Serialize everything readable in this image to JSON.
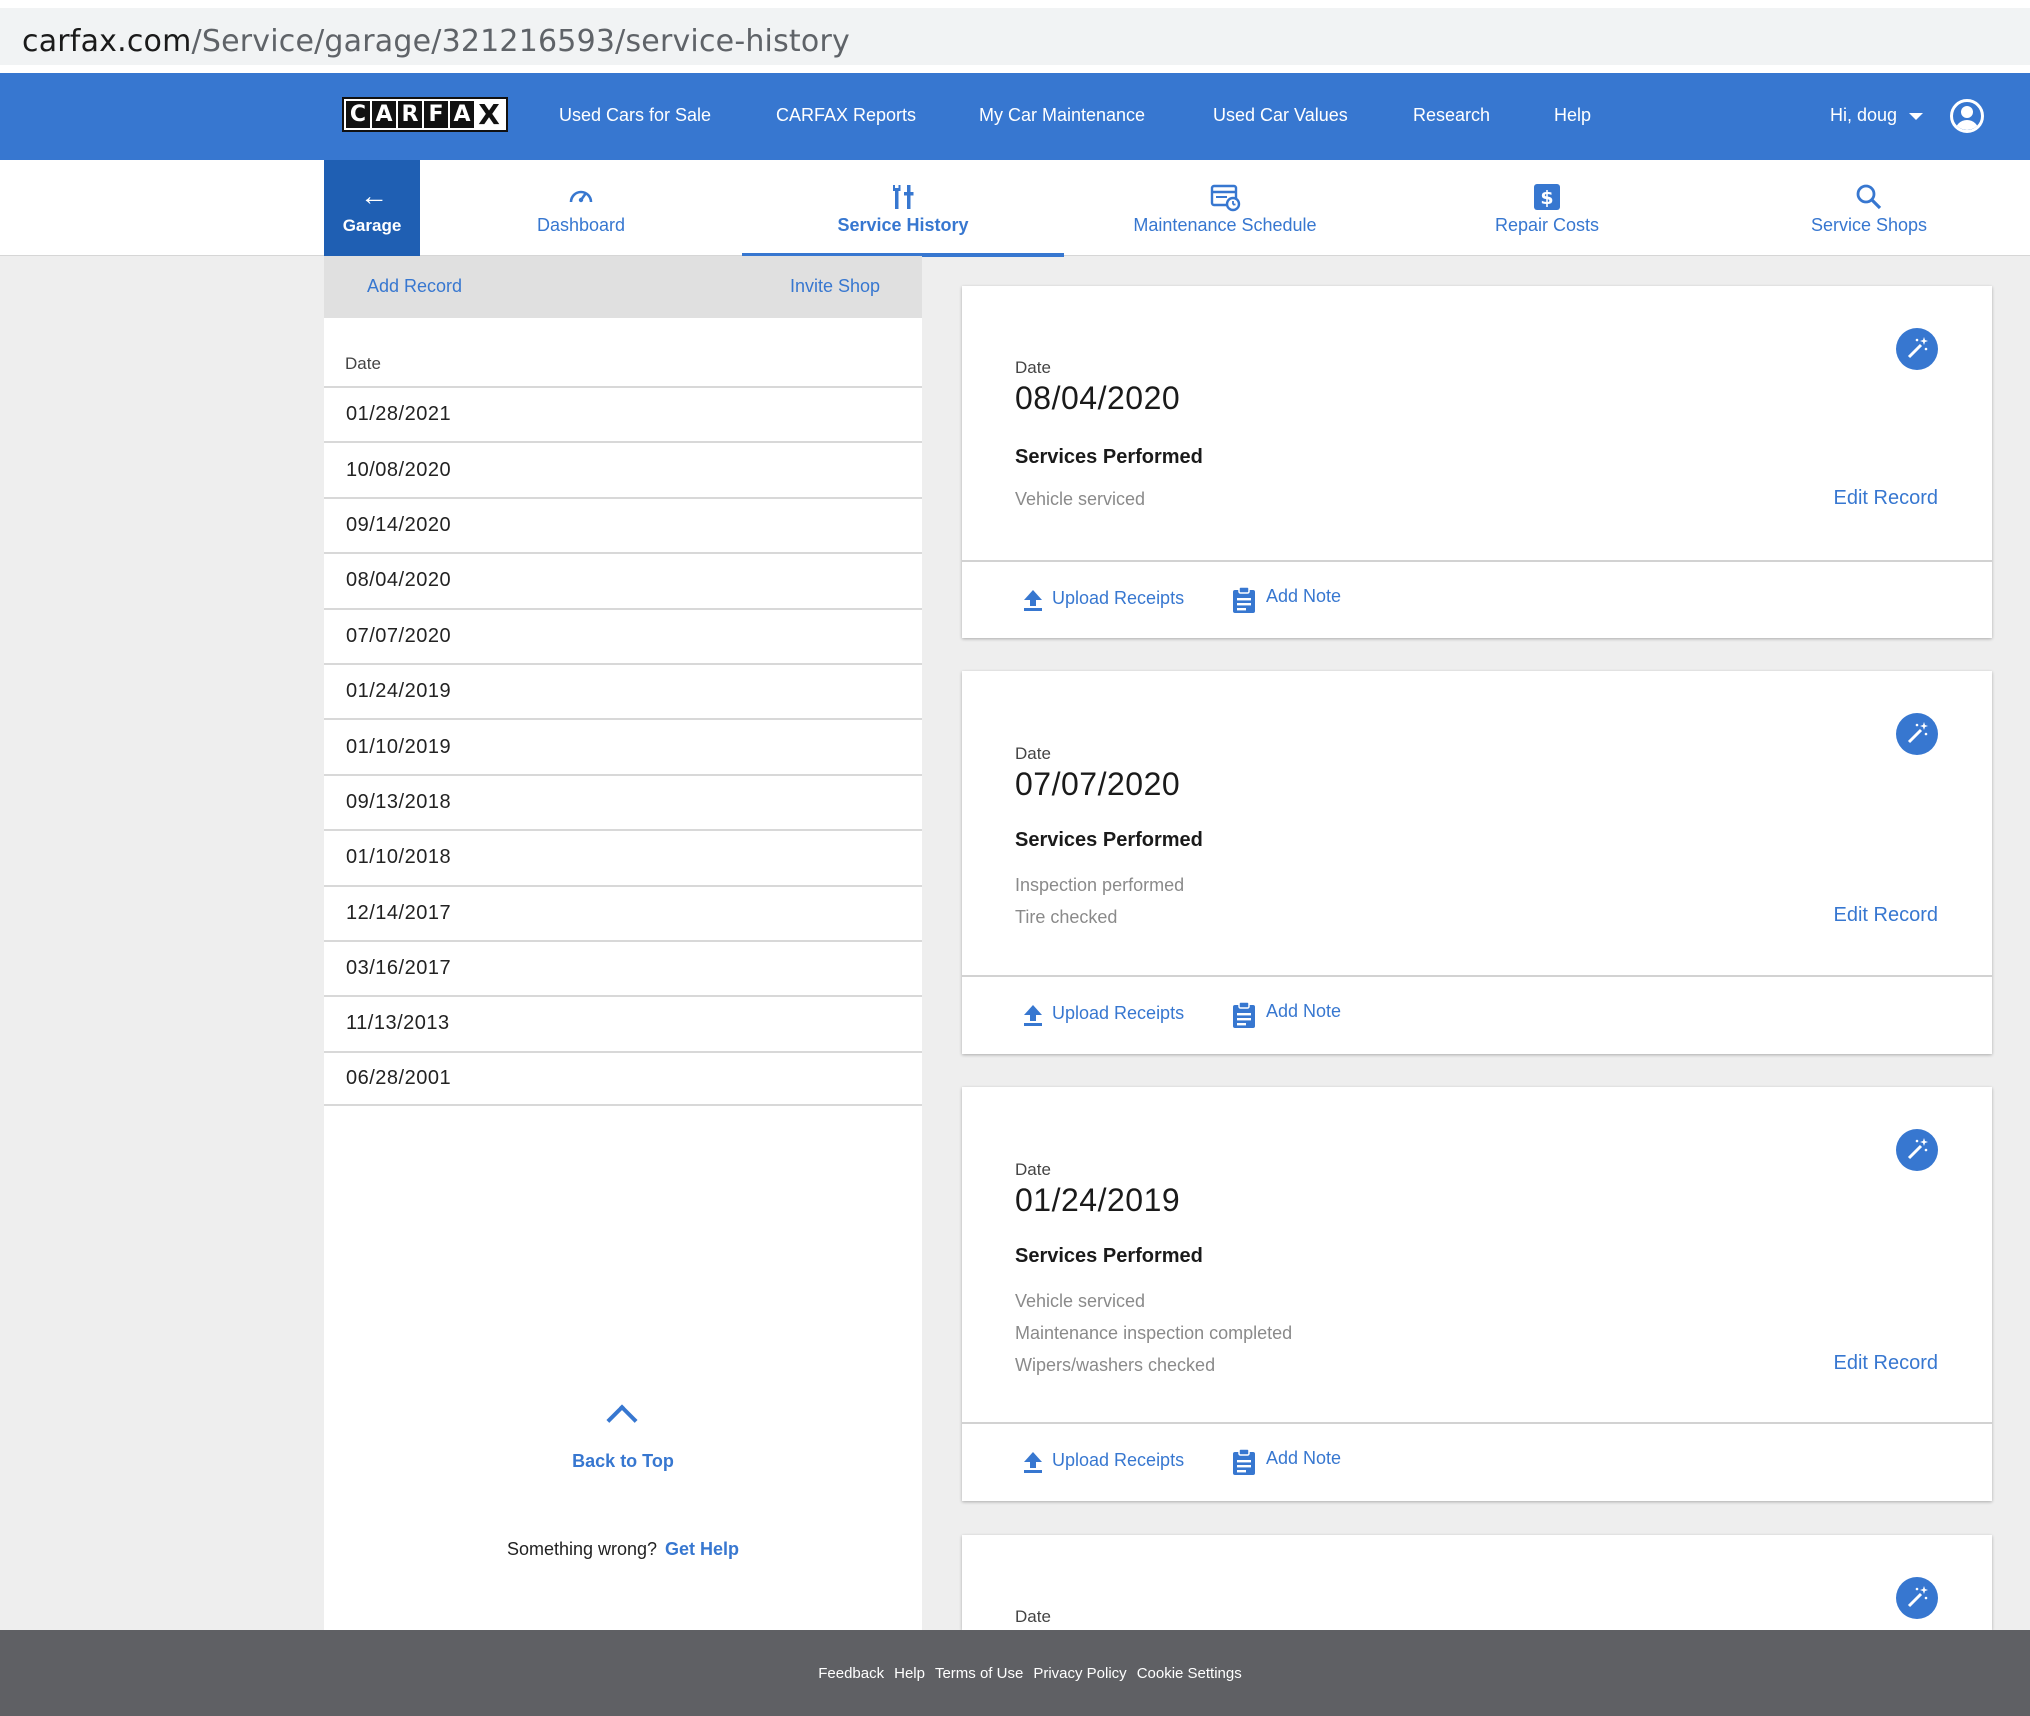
{
  "browser": {
    "url_domain": "carfax.com",
    "url_path": "/Service/garage/321216593/service-history"
  },
  "topnav": {
    "logo": [
      "C",
      "A",
      "R",
      "F",
      "A",
      "X"
    ],
    "links": [
      "Used Cars for Sale",
      "CARFAX Reports",
      "My Car Maintenance",
      "Used Car Values",
      "Research",
      "Help"
    ],
    "user_greeting": "Hi, doug",
    "brand_color": "#3777d0"
  },
  "subnav": {
    "garage_label": "Garage",
    "tabs": [
      {
        "label": "Dashboard",
        "icon": "speedometer-icon"
      },
      {
        "label": "Service History",
        "icon": "wrench-icon",
        "active": true
      },
      {
        "label": "Maintenance Schedule",
        "icon": "schedule-icon"
      },
      {
        "label": "Repair Costs",
        "icon": "dollar-icon"
      },
      {
        "label": "Service Shops",
        "icon": "search-icon"
      }
    ]
  },
  "left_panel": {
    "add_record": "Add Record",
    "invite_shop": "Invite Shop",
    "date_header": "Date",
    "dates": [
      "01/28/2021",
      "10/08/2020",
      "09/14/2020",
      "08/04/2020",
      "07/07/2020",
      "01/24/2019",
      "01/10/2019",
      "09/13/2018",
      "01/10/2018",
      "12/14/2017",
      "03/16/2017",
      "11/13/2013",
      "06/28/2001"
    ],
    "back_to_top": "Back to Top",
    "something_wrong": "Something wrong?",
    "get_help": "Get Help"
  },
  "records": [
    {
      "date_label": "Date",
      "date": "08/04/2020",
      "services_label": "Services Performed",
      "services": [
        "Vehicle serviced"
      ],
      "edit": "Edit Record",
      "upload": "Upload Receipts",
      "note": "Add Note"
    },
    {
      "date_label": "Date",
      "date": "07/07/2020",
      "services_label": "Services Performed",
      "services": [
        "Inspection performed",
        "Tire checked"
      ],
      "edit": "Edit Record",
      "upload": "Upload Receipts",
      "note": "Add Note"
    },
    {
      "date_label": "Date",
      "date": "01/24/2019",
      "services_label": "Services Performed",
      "services": [
        "Vehicle serviced",
        "Maintenance inspection completed",
        "Wipers/washers checked"
      ],
      "edit": "Edit Record",
      "upload": "Upload Receipts",
      "note": "Add Note"
    },
    {
      "date_label": "Date"
    }
  ],
  "footer": {
    "links": [
      "Feedback",
      "Help",
      "Terms of Use",
      "Privacy Policy",
      "Cookie Settings"
    ]
  }
}
